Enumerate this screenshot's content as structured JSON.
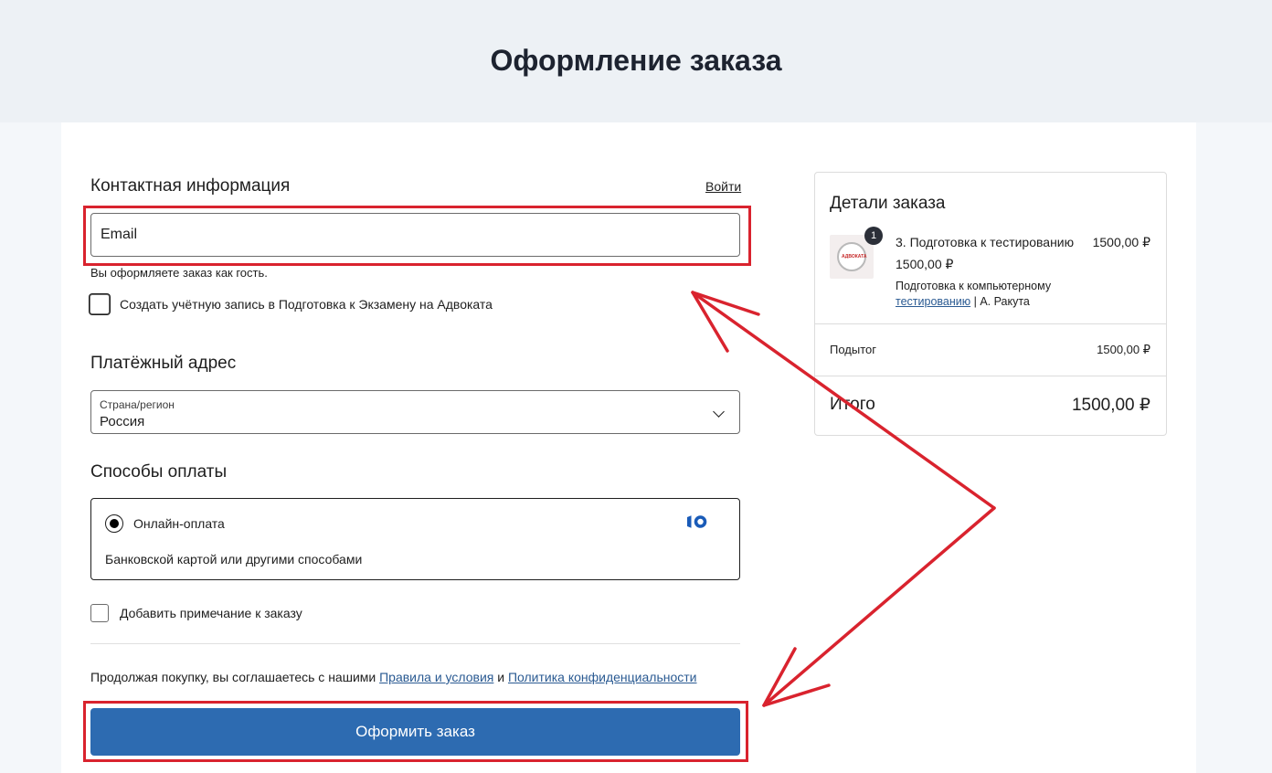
{
  "header": {
    "title": "Оформление заказа"
  },
  "contact": {
    "title": "Контактная информация",
    "login_link": "Войти",
    "email_placeholder": "Email",
    "guest_note": "Вы оформляете заказ как гость.",
    "create_account_label": "Создать учётную запись в Подготовка к Экзамену на Адвоката"
  },
  "billing": {
    "title": "Платёжный адрес",
    "country_label": "Страна/регион",
    "country_value": "Россия"
  },
  "payment": {
    "title": "Способы оплаты",
    "method_label": "Онлайн-оплата",
    "method_description": "Банковской картой или другими способами",
    "method_icon": "yoomoney-icon",
    "method_selected": true
  },
  "order_note": {
    "label": "Добавить примечание к заказу"
  },
  "terms": {
    "prefix": "Продолжая покупку, вы соглашаетесь с нашими",
    "terms_link": "Правила и условия",
    "conjunction": "и",
    "privacy_link": "Политика конфиденциальности"
  },
  "actions": {
    "place_order": "Оформить заказ"
  },
  "summary": {
    "title": "Детали заказа",
    "item": {
      "quantity": "1",
      "name": "3. Подготовка к тестированию",
      "price_line": "1500,00 ₽",
      "price": "1500,00 ₽",
      "description_prefix": "Подготовка к компьютерному",
      "description_link": "тестированию",
      "description_suffix": "| А. Ракута",
      "thumbnail_text": "АДВОКАТА"
    },
    "subtotal_label": "Подытог",
    "subtotal_value": "1500,00 ₽",
    "total_label": "Итого",
    "total_value": "1500,00 ₽"
  },
  "colors": {
    "primary_button": "#2d6bb1",
    "link": "#2a5a92",
    "annotation": "#d9232e",
    "header_bg": "#edf1f5"
  }
}
